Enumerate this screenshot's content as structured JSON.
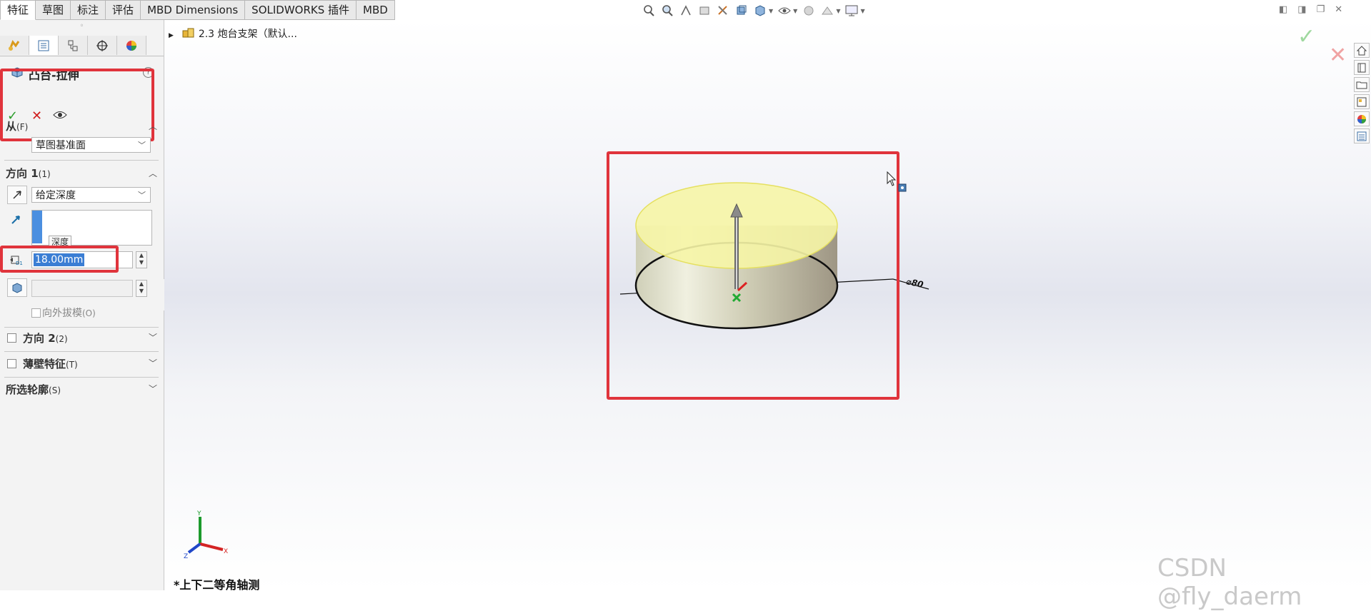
{
  "tabs": [
    "特征",
    "草图",
    "标注",
    "评估",
    "MBD Dimensions",
    "SOLIDWORKS 插件",
    "MBD"
  ],
  "active_tab_index": 0,
  "tree": {
    "label": "2.3 炮台支架（默认..."
  },
  "feature": {
    "title": "凸台-拉伸",
    "help": "?"
  },
  "from_section": {
    "title": "从",
    "accel": "(F)",
    "selected": "草图基准面"
  },
  "direction1": {
    "title": "方向 1",
    "accel": "(1)",
    "end_condition": "给定深度",
    "tooltip": "深度",
    "depth_value": "18.00mm",
    "draft_outward_label": "向外拔模",
    "draft_outward_accel": "(O)"
  },
  "direction2": {
    "title": "方向 2",
    "accel": "(2)"
  },
  "thin_feature": {
    "title": "薄壁特征",
    "accel": "(T)"
  },
  "selected_contours": {
    "title": "所选轮廓",
    "accel": "(S)"
  },
  "viewport": {
    "dimension_label": "⌀80",
    "view_name": "*上下二等角轴测",
    "triad": {
      "x": "X",
      "y": "Y",
      "z": "Z"
    }
  },
  "watermark": "CSDN @fly_daerm",
  "colors": {
    "highlight_red": "#e0343c",
    "ok_green": "#2a9d2a",
    "cancel_red": "#d01e1e",
    "selection_blue": "#3b7ed4",
    "face_yellow": "#f6f5a6"
  }
}
